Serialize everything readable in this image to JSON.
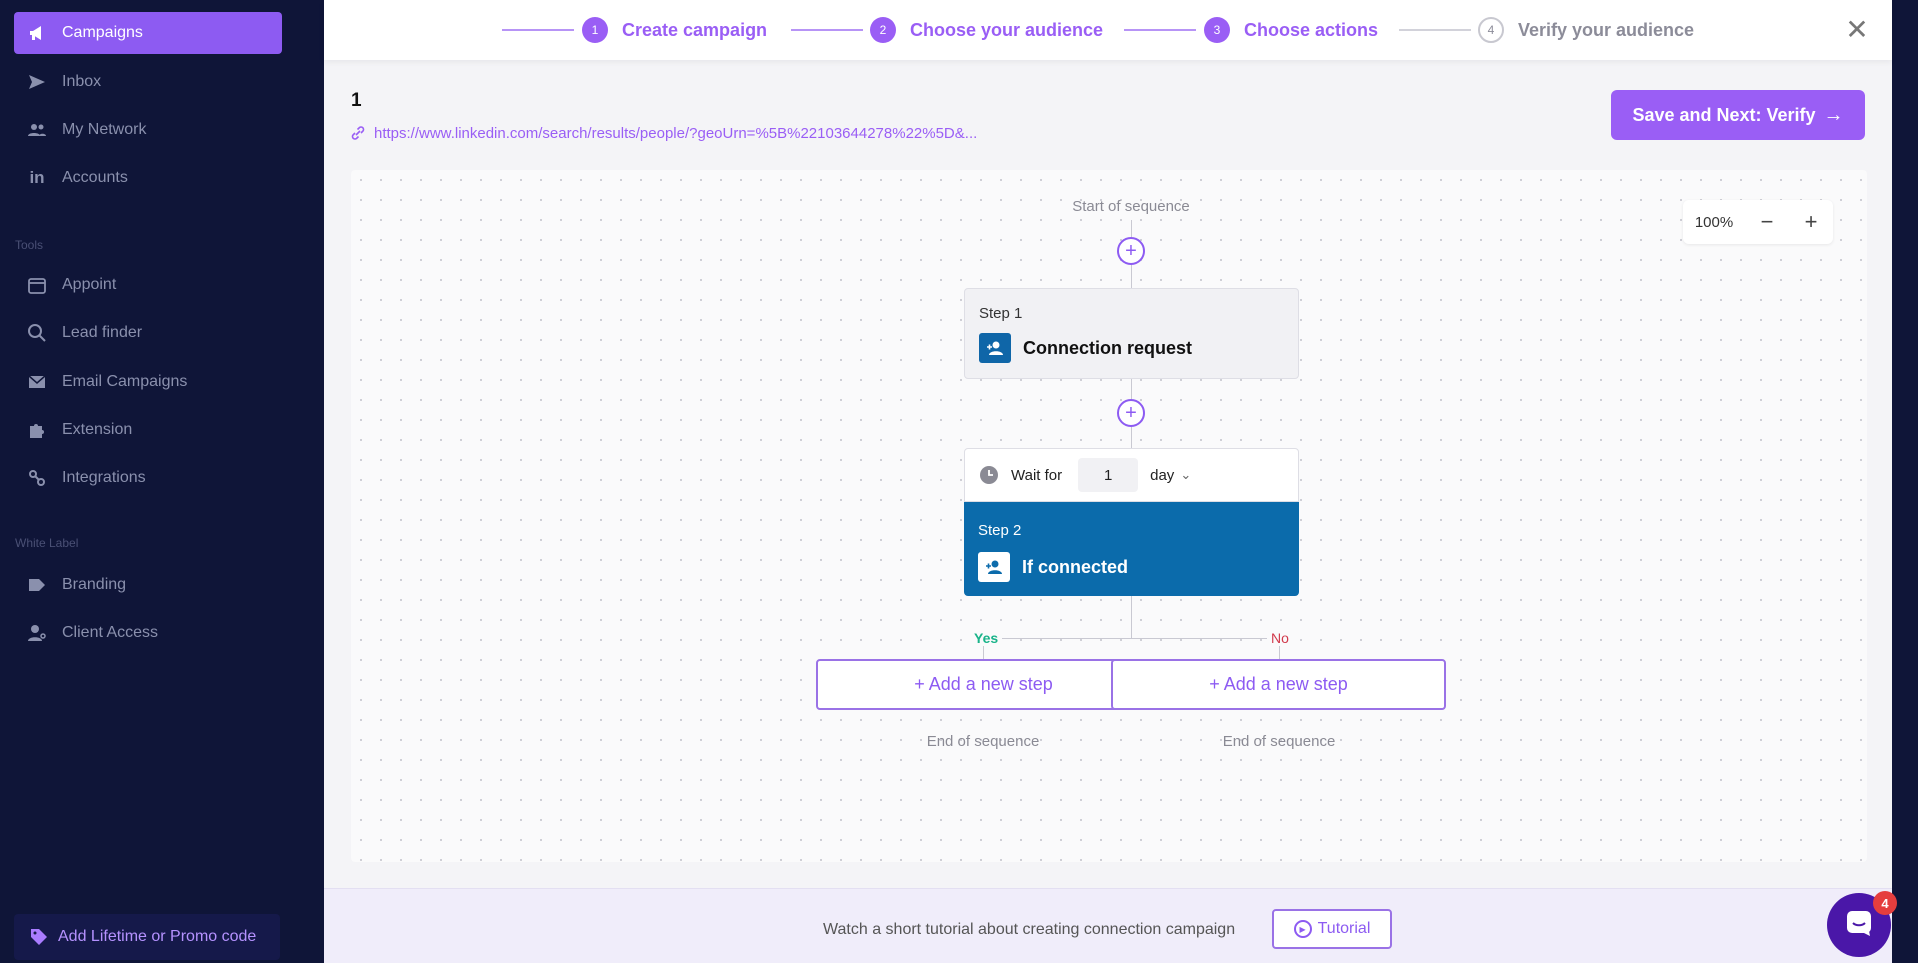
{
  "sidebar": {
    "items": [
      {
        "label": "Campaigns",
        "icon": "megaphone-icon"
      },
      {
        "label": "Inbox",
        "icon": "send-icon"
      },
      {
        "label": "My Network",
        "icon": "people-icon"
      },
      {
        "label": "Accounts",
        "icon": "linkedin-icon"
      },
      {
        "label": "Appoint",
        "icon": "calendar-icon"
      },
      {
        "label": "Lead finder",
        "icon": "search-icon"
      },
      {
        "label": "Email Campaigns",
        "icon": "mail-icon"
      },
      {
        "label": "Extension",
        "icon": "puzzle-icon"
      },
      {
        "label": "Integrations",
        "icon": "integrations-icon"
      },
      {
        "label": "Branding",
        "icon": "tag-icon"
      },
      {
        "label": "Client Access",
        "icon": "user-key-icon"
      }
    ],
    "section_tools": "Tools",
    "section_white_label": "White Label",
    "promo_label": "Add Lifetime or Promo code"
  },
  "stepper": {
    "steps": [
      {
        "num": "1",
        "label": "Create campaign"
      },
      {
        "num": "2",
        "label": "Choose your audience"
      },
      {
        "num": "3",
        "label": "Choose actions"
      },
      {
        "num": "4",
        "label": "Verify your audience"
      }
    ],
    "close_symbol": "✕"
  },
  "campaign": {
    "name": "1",
    "url": "https://www.linkedin.com/search/results/people/?geoUrn=%5B%22103644278%22%5D&..."
  },
  "save_button": {
    "label": "Save and Next: Verify",
    "arrow": "→"
  },
  "zoom": {
    "value": "100%",
    "minus": "−",
    "plus": "+"
  },
  "sequence": {
    "start_label": "Start of sequence",
    "plus_symbol": "+",
    "step1": {
      "label": "Step 1",
      "title": "Connection request"
    },
    "wait": {
      "label": "Wait for",
      "value": "1",
      "unit": "day"
    },
    "step2": {
      "label": "Step 2",
      "title": "If connected"
    },
    "branch_yes": "Yes",
    "branch_no": "No",
    "add_step_label": "+ Add a new step",
    "end_label": "End of sequence"
  },
  "footer": {
    "text": "Watch a short tutorial about creating connection campaign",
    "tutorial_label": "Tutorial"
  },
  "chat": {
    "badge": "4"
  },
  "colors": {
    "accent": "#9a5ef5",
    "sidebar_bg": "#0f1538",
    "step_blue": "#0b6bab",
    "yes_green": "#19b389",
    "no_red": "#d1394b"
  }
}
